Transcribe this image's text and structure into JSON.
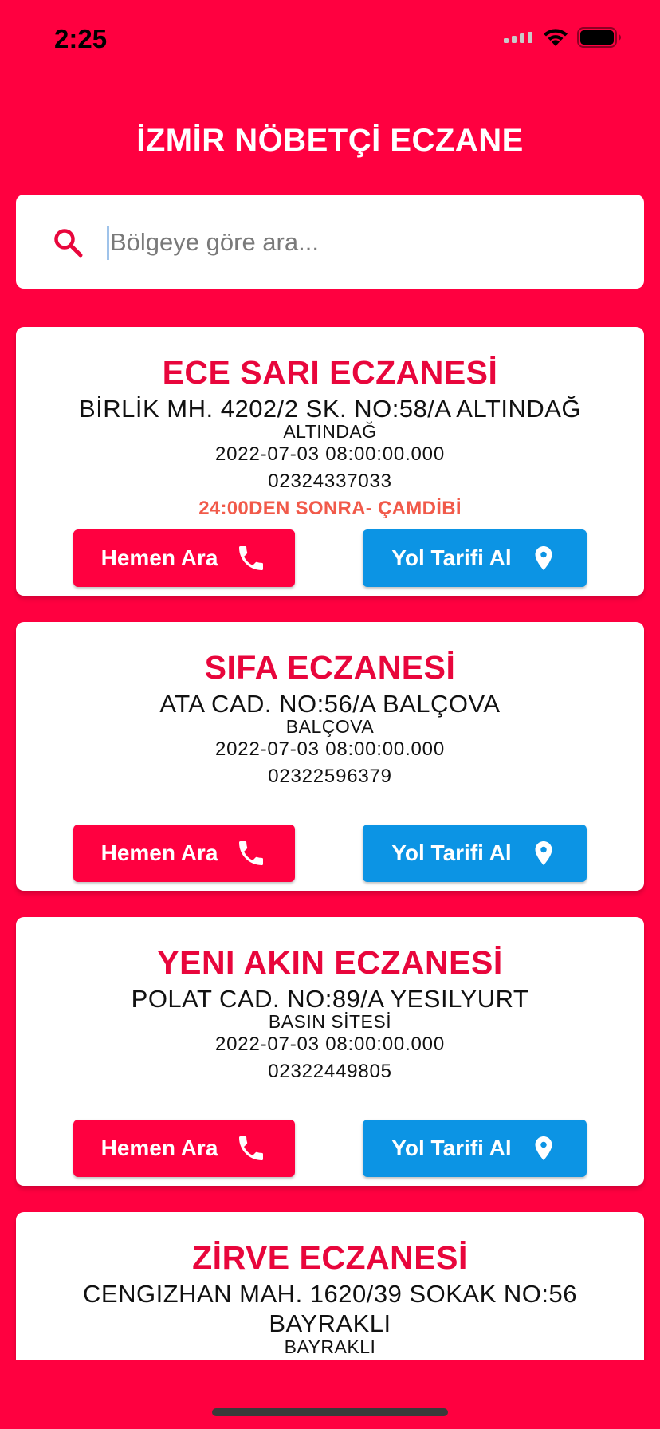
{
  "status_bar": {
    "time": "2:25"
  },
  "app": {
    "title": "İZMİR NÖBETÇİ ECZANE"
  },
  "search": {
    "placeholder": "Bölgeye göre ara...",
    "value": ""
  },
  "buttons": {
    "call_label": "Hemen Ara",
    "route_label": "Yol Tarifi Al"
  },
  "colors": {
    "accent": "#FF0040",
    "name_red": "#E8063C",
    "route_blue": "#0C94E4",
    "note_orange": "#F15A4A"
  },
  "pharmacies": [
    {
      "name": "ECE SARI ECZANESİ",
      "address": "BİRLİK MH. 4202/2 SK. NO:58/A ALTINDAĞ",
      "district": "ALTINDAĞ",
      "date": "2022-07-03 08:00:00.000",
      "phone": "02324337033",
      "note": "24:00DEN SONRA- ÇAMDİBİ"
    },
    {
      "name": "SIFA ECZANESİ",
      "address": "ATA CAD. NO:56/A BALÇOVA",
      "district": "BALÇOVA",
      "date": "2022-07-03 08:00:00.000",
      "phone": "02322596379",
      "note": ""
    },
    {
      "name": "YENI AKIN ECZANESİ",
      "address": "POLAT CAD. NO:89/A YESILYURT",
      "district": "BASIN SİTESİ",
      "date": "2022-07-03 08:00:00.000",
      "phone": "02322449805",
      "note": ""
    },
    {
      "name": "ZİRVE ECZANESİ",
      "address": "CENGIZHAN MAH. 1620/39 SOKAK NO:56 BAYRAKLI",
      "district": "BAYRAKLI",
      "date": "",
      "phone": "",
      "note": ""
    }
  ]
}
